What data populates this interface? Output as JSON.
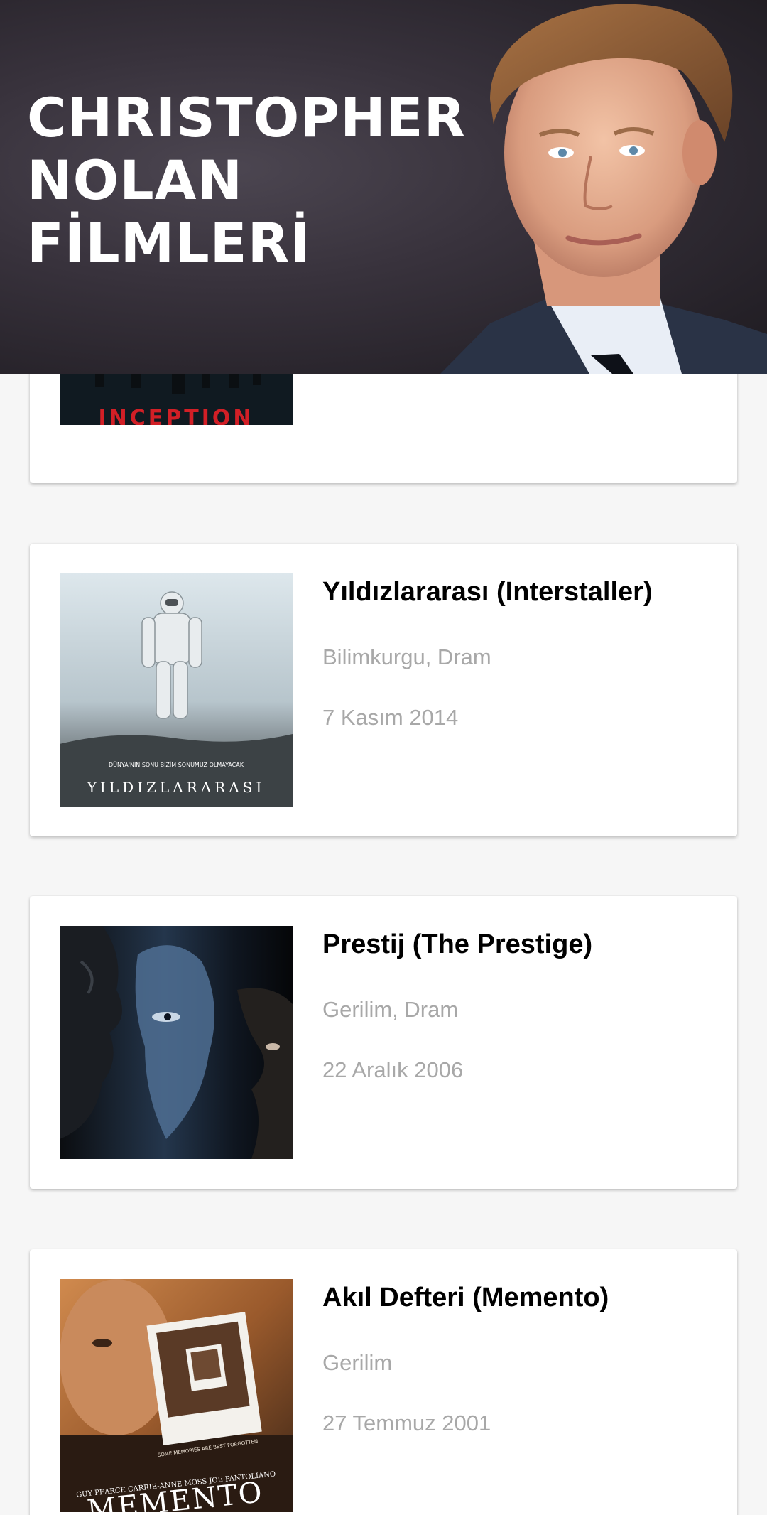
{
  "header": {
    "title": "CHRISTOPHER\nNOLAN\nFİLMLERİ"
  },
  "movies": [
    {
      "title": "",
      "genre": "",
      "date": "",
      "poster_text": "INCEPTION"
    },
    {
      "title": "Yıldızlararası (Interstaller)",
      "genre": "Bilimkurgu, Dram",
      "date": "7 Kasım 2014",
      "poster_text": "YILDIZLARARASI",
      "poster_tagline": "DÜNYA'NIN SONU BİZİM SONUMUZ OLMAYACAK"
    },
    {
      "title": "Prestij (The Prestige)",
      "genre": "Gerilim, Dram",
      "date": "22 Aralık 2006"
    },
    {
      "title": "Akıl Defteri (Memento)",
      "genre": "Gerilim",
      "date": "27 Temmuz 2001",
      "poster_text": "MEMENTO",
      "poster_cast": "GUY PEARCE  CARRIE-ANNE MOSS  JOE PANTOLIANO",
      "poster_tagline": "SOME MEMORIES ARE BEST FORGOTTEN."
    }
  ],
  "colors": {
    "background": "#f6f6f6",
    "card": "#ffffff",
    "title_text": "#000000",
    "secondary_text": "#a8a8a8",
    "banner_bg": "#2c2730"
  }
}
